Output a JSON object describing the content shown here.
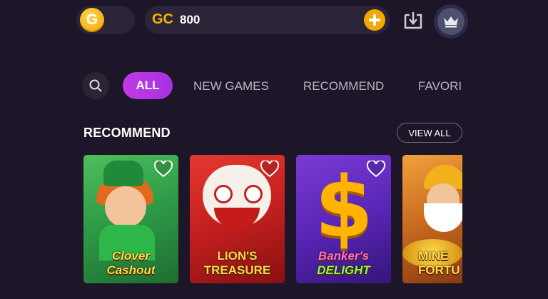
{
  "top_bar": {
    "g_coin_letter": "G",
    "gc_label": "GC",
    "gc_value": "800",
    "icons": [
      "plus-icon",
      "download-icon",
      "crown-icon"
    ],
    "accent": "#f5b400"
  },
  "tabs": {
    "search_icon": "search-icon",
    "items": [
      {
        "label": "ALL",
        "active": true
      },
      {
        "label": "NEW GAMES",
        "active": false
      },
      {
        "label": "RECOMMEND",
        "active": false
      },
      {
        "label": "FAVORI",
        "active": false
      }
    ],
    "active_color": "#b935e4"
  },
  "section": {
    "title": "RECOMMEND",
    "view_all_label": "VIEW ALL"
  },
  "games": [
    {
      "title_line1": "Clover",
      "title_line2": "Cashout"
    },
    {
      "title_line1": "LION'S",
      "title_line2": "TREASURE"
    },
    {
      "title_line1": "Banker's",
      "title_line2": "DELIGHT"
    },
    {
      "title_line1": "MINE",
      "title_line2": "FORTU"
    }
  ]
}
